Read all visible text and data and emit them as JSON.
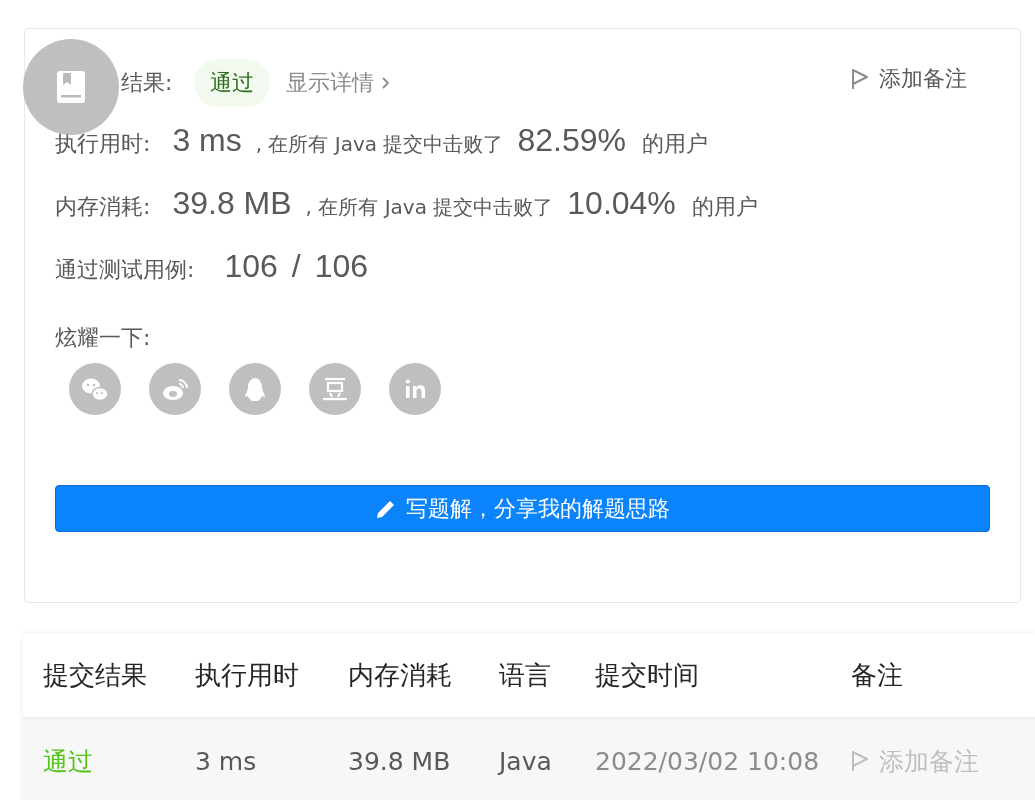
{
  "result": {
    "label": "结果:",
    "status": "通过",
    "details_link": "显示详情",
    "add_note": "添加备注"
  },
  "stats": [
    {
      "label": "执行用时:",
      "value": "3 ms",
      "text_before": ", 在所有 Java 提交中击败了",
      "percent": "82.59%",
      "text_after": "的用户"
    },
    {
      "label": "内存消耗:",
      "value": "39.8 MB",
      "text_before": ", 在所有 Java 提交中击败了",
      "percent": "10.04%",
      "text_after": "的用户"
    }
  ],
  "tests": {
    "label": "通过测试用例:",
    "passed": "106",
    "separator": "/",
    "total": "106"
  },
  "share": {
    "label": "炫耀一下:",
    "icons": [
      {
        "kind": "wechat"
      },
      {
        "kind": "weibo"
      },
      {
        "kind": "qq"
      },
      {
        "kind": "douban"
      },
      {
        "kind": "linkedin"
      }
    ]
  },
  "write_button": {
    "label": "写题解，分享我的解题思路"
  },
  "submissions": {
    "columns": [
      "提交结果",
      "执行用时",
      "内存消耗",
      "语言",
      "提交时间",
      "备注"
    ],
    "rows": [
      {
        "status": "通过",
        "runtime": "3 ms",
        "memory": "39.8 MB",
        "language": "Java",
        "time": "2022/03/02 10:08",
        "note": "添加备注"
      }
    ]
  }
}
